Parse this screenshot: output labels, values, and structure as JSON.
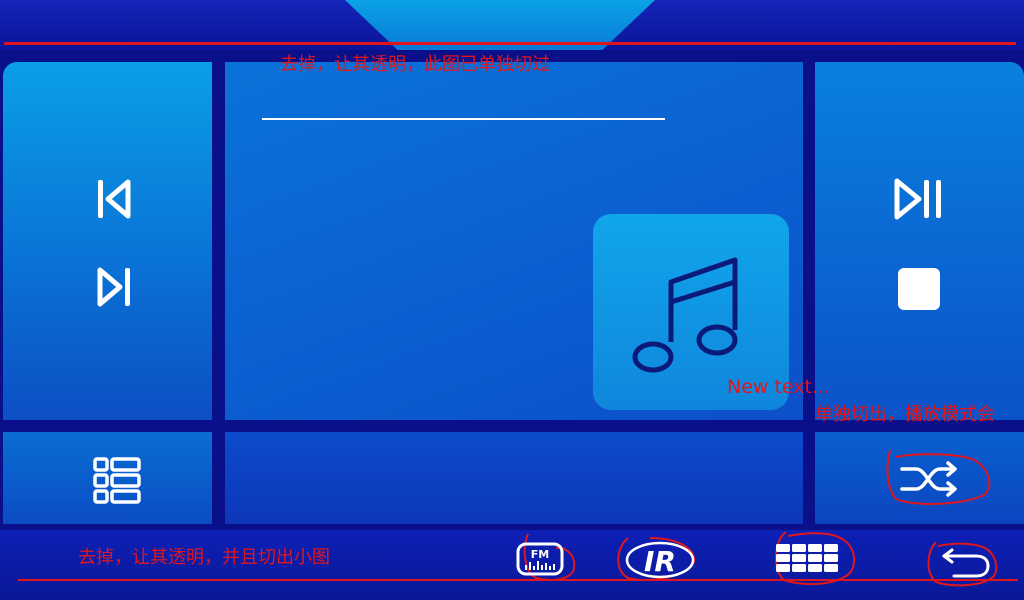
{
  "annotations": {
    "top_note": "去掉，让其透明，此图已单独切过",
    "bottom_note": "去掉，让其透明，并且切出小图",
    "new_text": "New text...",
    "mode_note": "单独切出，播放模式会"
  },
  "player": {
    "icons": {
      "prev": "skip-previous-icon",
      "next": "skip-next-icon",
      "play_pause": "play-pause-icon",
      "stop": "stop-icon",
      "playlist": "playlist-grid-icon",
      "shuffle": "shuffle-icon",
      "album_art": "music-note-icon"
    }
  },
  "bottom_nav": {
    "fm_label": "FM",
    "ir_label": "IR",
    "icons": [
      "radio-fm-icon",
      "ir-icon",
      "keyboard-grid-icon",
      "back-icon"
    ]
  },
  "colors": {
    "background": "#0a0f8a",
    "accent": "#0a9fe6",
    "annotation_red": "#e0161c"
  }
}
